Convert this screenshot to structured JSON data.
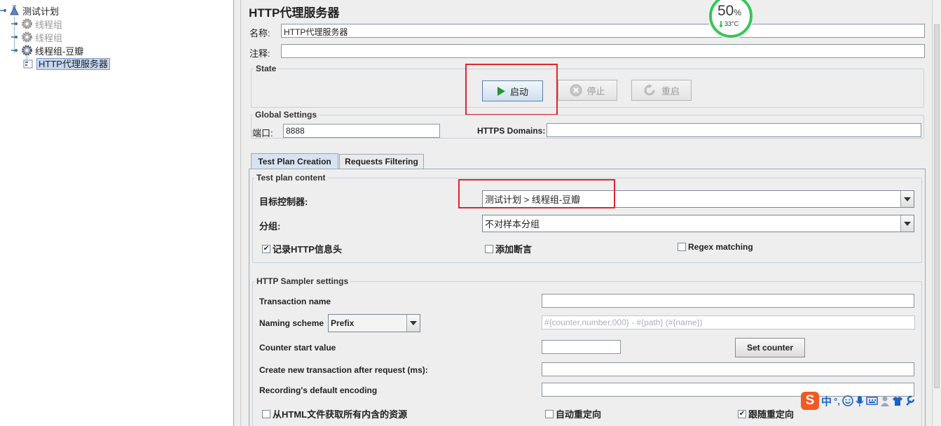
{
  "tree": {
    "root": {
      "label": "测试计划"
    },
    "items": [
      {
        "label": "线程组",
        "disabled": true
      },
      {
        "label": "线程组",
        "disabled": true
      },
      {
        "label": "线程组-豆瓣",
        "disabled": false
      },
      {
        "label": "HTTP代理服务器",
        "selected": true
      }
    ]
  },
  "panel": {
    "title": "HTTP代理服务器",
    "name_label": "名称:",
    "name_value": "HTTP代理服务器",
    "comment_label": "注释:",
    "comment_value": ""
  },
  "state": {
    "title": "State",
    "start_label": "启动",
    "stop_label": "停止",
    "restart_label": "重启"
  },
  "global": {
    "title": "Global Settings",
    "port_label": "端口:",
    "port_value": "8888",
    "https_label": "HTTPS Domains:",
    "https_value": ""
  },
  "tabs": [
    {
      "label": "Test Plan Creation",
      "active": true
    },
    {
      "label": "Requests Filtering",
      "active": false
    }
  ],
  "test_plan_content": {
    "title": "Test plan content",
    "target_label": "目标控制器:",
    "target_value": "测试计划 > 线程组-豆瓣",
    "group_label": "分组:",
    "group_value": "不对样本分组",
    "record_headers_label": "记录HTTP信息头",
    "record_headers_checked": true,
    "add_assertions_label": "添加断言",
    "add_assertions_checked": false,
    "regex_label": "Regex matching",
    "regex_checked": false
  },
  "sampler": {
    "title": "HTTP Sampler settings",
    "transaction_label": "Transaction name",
    "transaction_value": "",
    "naming_label": "Naming scheme",
    "naming_value": "Prefix",
    "naming_placeholder": "#{counter,number,000} - #{path} (#{name})",
    "counter_label": "Counter start value",
    "counter_value": "",
    "set_counter_label": "Set counter",
    "new_transaction_label": "Create new transaction after request (ms):",
    "new_transaction_value": "",
    "encoding_label": "Recording's default encoding",
    "encoding_value": "",
    "fetch_resources_label": "从HTML文件获取所有内含的资源",
    "fetch_resources_checked": false,
    "auto_redirect_label": "自动重定向",
    "auto_redirect_checked": false,
    "follow_redirect_label": "跟随重定向",
    "follow_redirect_checked": true
  },
  "overlay": {
    "cpu_percent": "50",
    "cpu_unit": "%",
    "temperature": "33°C",
    "ime_mode": "中",
    "ime_punct": "°,",
    "accent_red": "#e0252b",
    "meter_green": "#38c45a"
  }
}
